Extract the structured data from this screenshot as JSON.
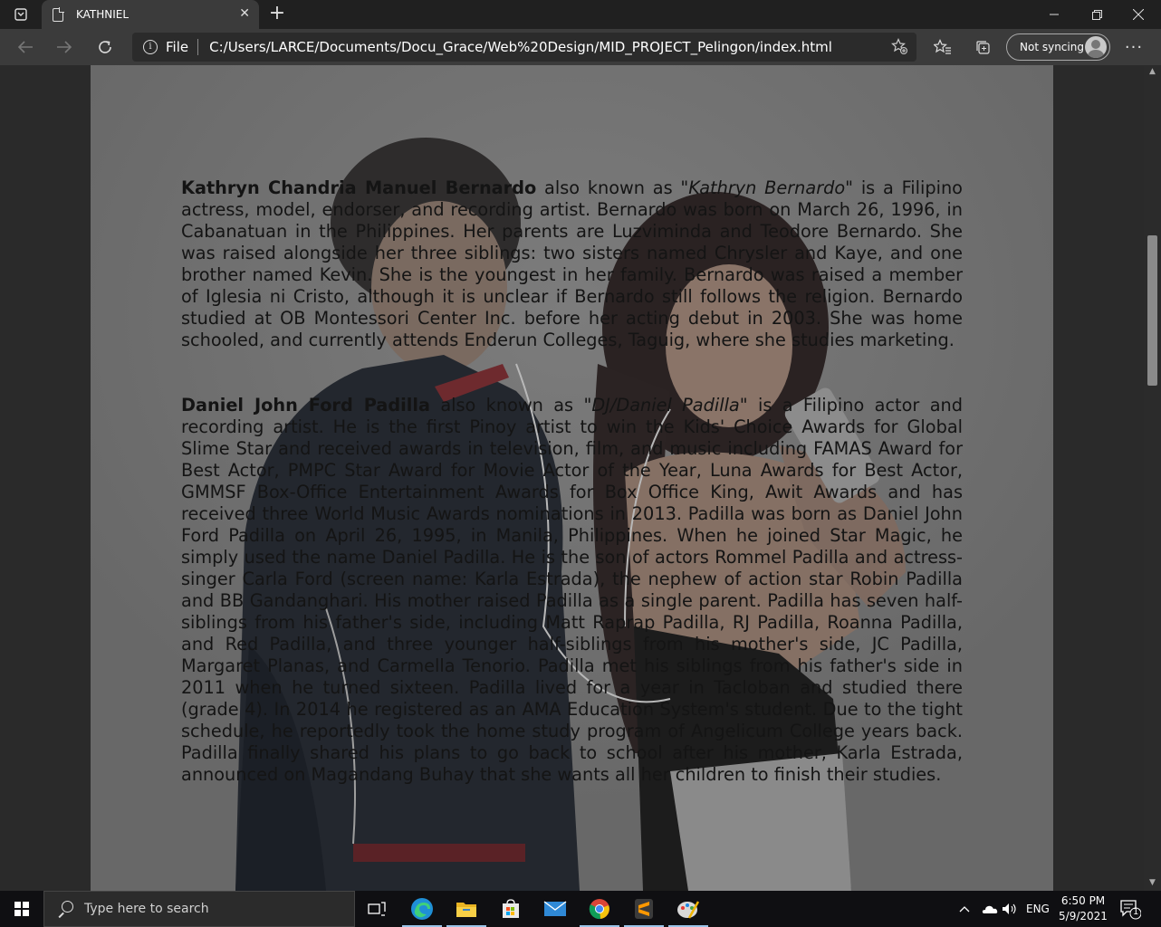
{
  "browser": {
    "tab_title": "KATHNIEL",
    "new_tab_symbol": "+",
    "file_label": "File",
    "url": "C:/Users/LARCE/Documents/Docu_Grace/Web%20Design/MID_PROJECT_Pelingon/index.html",
    "sync_label": "Not syncing"
  },
  "content": {
    "p1": {
      "name": "Kathryn Chandria Manuel Bernardo",
      "aka_prefix": " also known as ",
      "aka": "\"Kathryn Bernardo\"",
      "text": " is a Filipino actress, model, endorser, and recording artist. Bernardo was born on March 26, 1996, in Cabanatuan in the Philippines. Her parents are Luzviminda and Teodore Bernardo. She was raised alongside her three siblings: two sisters named Chrysler and Kaye, and one brother named Kevin. She is the youngest in her family. Bernardo was raised a member of Iglesia ni Cristo, although it is unclear if Bernardo still follows the religion. Bernardo studied at OB Montessori Center Inc. before her acting debut in 2003. She was home schooled, and currently attends Enderun Colleges, Taguig, where she studies marketing."
    },
    "p2": {
      "name": "Daniel John Ford Padilla",
      "aka_prefix": " also known as ",
      "aka": "\"DJ/Daniel Padilla\"",
      "text": " is a Filipino actor and recording artist. He is the first Pinoy artist to win the Kids' Choice Awards for Global Slime Star and received awards in television, film, and music including FAMAS Award for Best Actor, PMPC Star Award for Movie Actor of the Year, Luna Awards for Best Actor, GMMSF Box-Office Entertainment Awards for Box Office King, Awit Awards and has received three World Music Awards nominations in 2013. Padilla was born as Daniel John Ford Padilla on April 26, 1995, in Manila, Philippines. When he joined Star Magic, he simply used the name Daniel Padilla. He is the son of actors Rommel Padilla and actress-singer Carla Ford (screen name: Karla Estrada), the nephew of action star Robin Padilla and BB Gandanghari. His mother raised Padilla as a single parent. Padilla has seven half-siblings from his father's side, including Matt Raprap Padilla, RJ Padilla, Roanna Padilla, and Red Padilla, and three younger half-siblings from his mother's side, JC Padilla, Margaret Planas, and Carmella Tenorio. Padilla met his siblings from his father's side in 2011 when he turned sixteen. Padilla lived for a year in Tacloban and studied there (grade 4). In 2014 he registered as an AMA Education System's student. Due to the tight schedule, he reportedly took the home study program of Angelicum College years back. Padilla finally shared his plans to go back to school after his mother, Karla Estrada, announced on Magandang Buhay that she wants all her children to finish their studies."
    }
  },
  "taskbar": {
    "search_placeholder": "Type here to search",
    "language": "ENG",
    "time": "6:50 PM",
    "date": "5/9/2021",
    "notification_count": "1"
  }
}
